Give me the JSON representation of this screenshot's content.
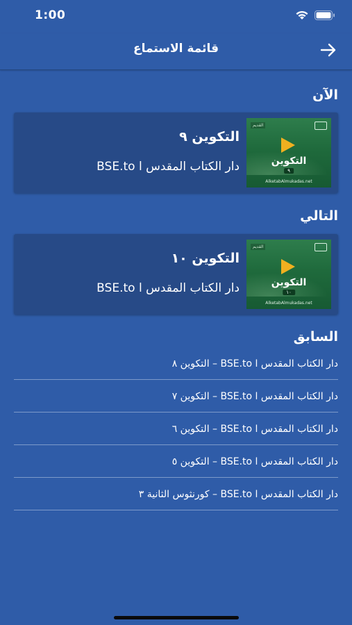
{
  "status_bar": {
    "time": "1:00"
  },
  "nav": {
    "title": "قائمة الاستماع"
  },
  "sections": {
    "now_title": "الآن",
    "next_title": "التالي",
    "previous_title": "السابق"
  },
  "now_card": {
    "title": "التكوين ٩",
    "subtitle": "دار الكتاب المقدس ا BSE.to",
    "thumb_word": "التكوين",
    "thumb_number": "٩",
    "thumb_tag": "القديم",
    "thumb_url": "AlketabAlmukadas.net"
  },
  "next_card": {
    "title": "التكوين ١٠",
    "subtitle": "دار الكتاب المقدس ا BSE.to",
    "thumb_word": "التكوين",
    "thumb_number": "١٠",
    "thumb_tag": "القديم",
    "thumb_url": "AlketabAlmukadas.net"
  },
  "previous_items": [
    "دار الكتاب المقدس ا BSE.to – التكوين ٨",
    "دار الكتاب المقدس ا BSE.to – التكوين ٧",
    "دار الكتاب المقدس ا BSE.to – التكوين ٦",
    "دار الكتاب المقدس ا BSE.to – التكوين ٥",
    "دار الكتاب المقدس ا BSE.to – كورنثوس الثانية ٣"
  ],
  "icons": {
    "back": "arrow-right-icon",
    "wifi": "wifi-icon",
    "battery": "battery-icon",
    "play": "play-icon"
  },
  "colors": {
    "background": "#2f5ca8",
    "card": "#274a87",
    "thumb_green": "#1f6a3c",
    "play_accent": "#f0b020"
  }
}
